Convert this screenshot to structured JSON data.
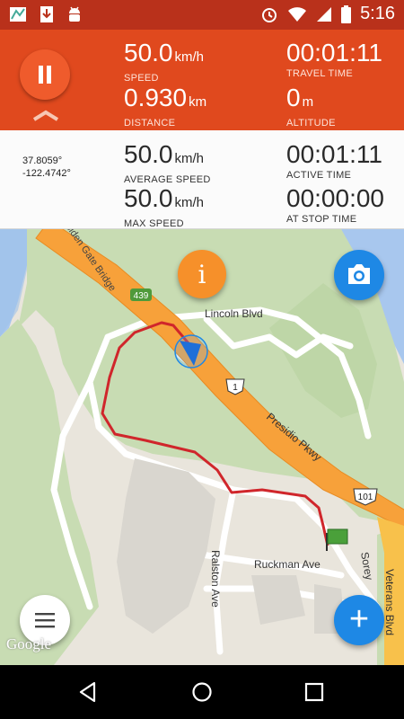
{
  "status_bar": {
    "time": "5:16",
    "icons": [
      "map-icon",
      "download-icon",
      "android-icon",
      "alarm-icon",
      "wifi-icon",
      "signal-icon",
      "battery-icon"
    ]
  },
  "panel_top": {
    "speed": {
      "value": "50.0",
      "unit": "km/h",
      "label": "SPEED"
    },
    "travel_time": {
      "value": "00:01:11",
      "label": "TRAVEL TIME"
    },
    "distance": {
      "value": "0.930",
      "unit": "km",
      "label": "DISTANCE"
    },
    "altitude": {
      "value": "0",
      "unit": "m",
      "label": "ALTITUDE"
    }
  },
  "panel_bottom": {
    "latitude": "37.8059°",
    "longitude": "-122.4742°",
    "average_speed": {
      "value": "50.0",
      "unit": "km/h",
      "label": "AVERAGE SPEED"
    },
    "active_time": {
      "value": "00:01:11",
      "label": "ACTIVE TIME"
    },
    "max_speed": {
      "value": "50.0",
      "unit": "km/h",
      "label": "MAX SPEED"
    },
    "at_stop_time": {
      "value": "00:00:00",
      "label": "AT STOP TIME"
    }
  },
  "map": {
    "labels": {
      "lincoln": "Lincoln Blvd",
      "presidio": "Presidio Pkwy",
      "ruckman": "Ruckman Ave",
      "ralston": "Ralston Ave",
      "sorey": "Sorey",
      "veterans": "Veterans Blvd",
      "bridge": "Golden Gate Bridge",
      "shield_439": "439",
      "shield_1": "1",
      "shield_101": "101"
    },
    "info_label": "i",
    "add_label": "+",
    "google": "Google"
  },
  "colors": {
    "header_orange": "#e0491e",
    "statusbar": "#b9311b",
    "route": "#d0262b",
    "highway": "#f7a13a",
    "fab_blue": "#1e88e5",
    "info_orange": "#f6902a"
  }
}
